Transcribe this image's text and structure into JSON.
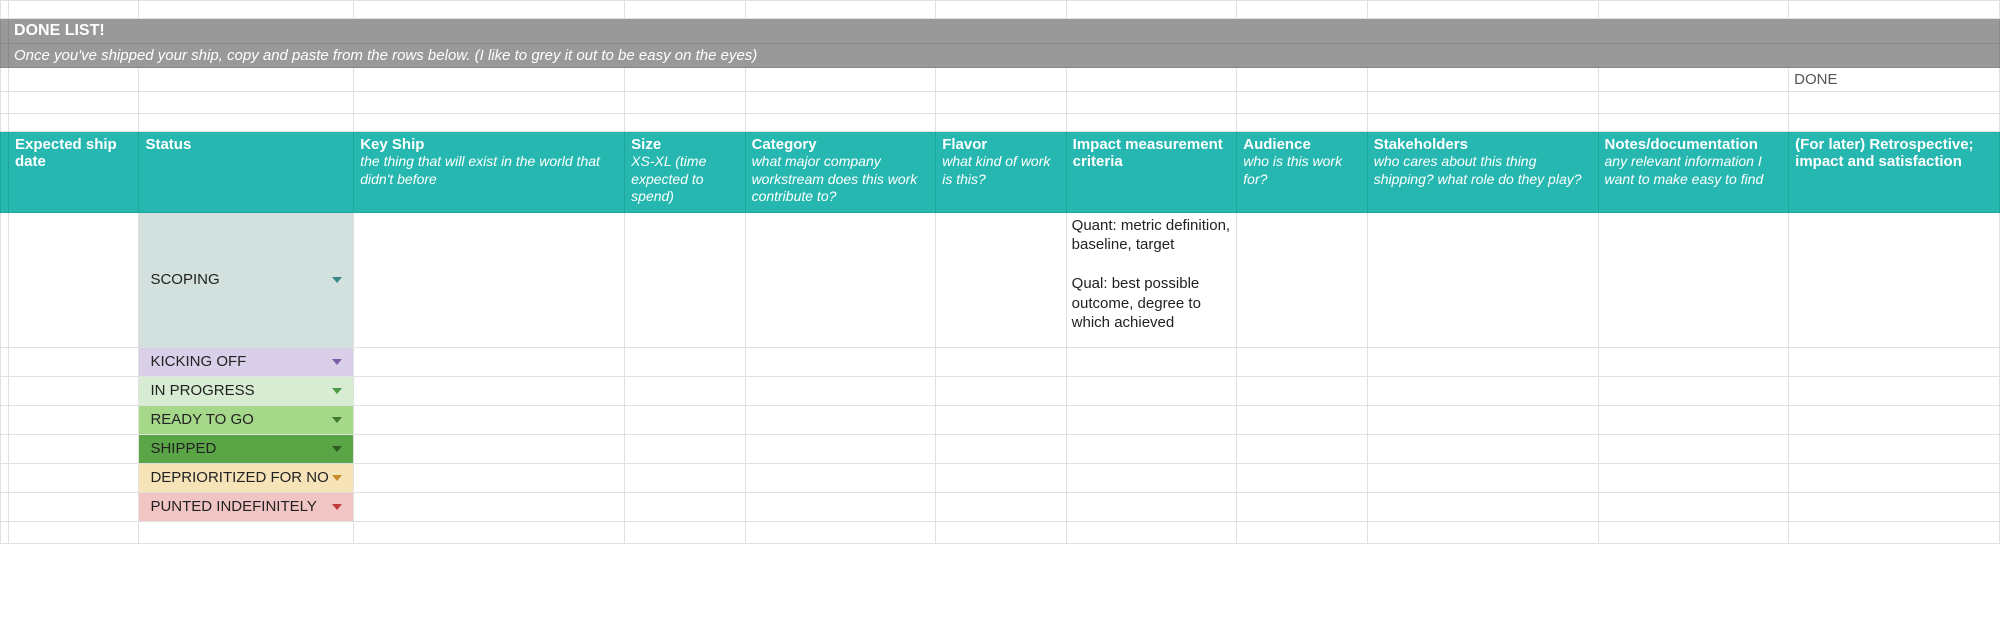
{
  "banner": {
    "title": "DONE LIST!",
    "subtitle": "Once you've shipped your ship, copy and paste from the rows below. (I like to grey it out to be easy on the eyes)"
  },
  "done_label": "DONE",
  "headers": [
    {
      "title": "Expected ship date",
      "sub": ""
    },
    {
      "title": "Status",
      "sub": ""
    },
    {
      "title": "Key Ship",
      "sub": "the thing that will exist in the world that didn't before"
    },
    {
      "title": "Size",
      "sub": "XS-XL (time expected to spend)"
    },
    {
      "title": "Category",
      "sub": "what major company workstream does this work contribute to?"
    },
    {
      "title": "Flavor",
      "sub": "what kind of work is this?"
    },
    {
      "title": "Impact measurement criteria",
      "sub": ""
    },
    {
      "title": "Audience",
      "sub": "who is this work for?"
    },
    {
      "title": "Stakeholders",
      "sub": "who cares about this thing shipping? what role do they play?"
    },
    {
      "title": "Notes/documentation",
      "sub": "any relevant information I want to make easy to find"
    },
    {
      "title": "(For later) Retrospective; impact and satisfaction",
      "sub": ""
    }
  ],
  "impact_hint": "Quant: metric definition, baseline, target\n\nQual: best possible outcome, degree to which achieved",
  "statuses": [
    {
      "label": "SCOPING",
      "bg": "#d2e0de",
      "arrow": "#3a8a8a",
      "tall": true
    },
    {
      "label": "KICKING OFF",
      "bg": "#d9cfe8",
      "arrow": "#7a5fa8"
    },
    {
      "label": "IN PROGRESS",
      "bg": "#d7ecd2",
      "arrow": "#4c9a46"
    },
    {
      "label": "READY TO GO",
      "bg": "#a6d88a",
      "arrow": "#3d7a2e"
    },
    {
      "label": "SHIPPED",
      "bg": "#5aa646",
      "arrow": "#2e5a22"
    },
    {
      "label": "DEPRIORITIZED FOR NO",
      "bg": "#f6e3b7",
      "arrow": "#c98a2a"
    },
    {
      "label": "PUNTED INDEFINITELY",
      "bg": "#f2c5c5",
      "arrow": "#c13a3a"
    }
  ]
}
